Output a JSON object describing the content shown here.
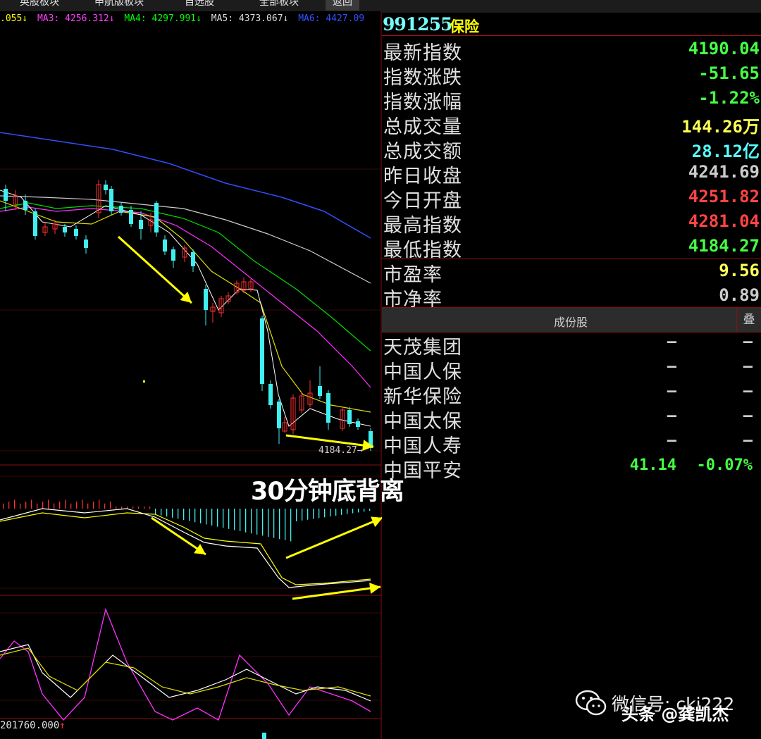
{
  "tabs": [
    {
      "label": "英股板块",
      "active": false
    },
    {
      "label": "申航版板块",
      "active": false
    },
    {
      "label": "自选股",
      "active": false
    },
    {
      "label": "全部板块",
      "active": false
    },
    {
      "label": "返回",
      "active": true
    }
  ],
  "ma_line": [
    {
      "text": ".055↓",
      "color": "#ffff00"
    },
    {
      "text": "MA3: 4256.312↓",
      "color": "#ff40ff"
    },
    {
      "text": "MA4: 4297.991↓",
      "color": "#00ff00"
    },
    {
      "text": "MA5: 4373.067↓",
      "color": "#dddddd"
    },
    {
      "text": "MA6: 4427.09",
      "color": "#3050ff"
    }
  ],
  "quote": {
    "code": "991255",
    "name": "保险",
    "rows": [
      {
        "label": "最新指数",
        "value": "4190.04",
        "color": "#44ff44"
      },
      {
        "label": "指数涨跌",
        "value": "-51.65",
        "color": "#44ff44"
      },
      {
        "label": "指数涨幅",
        "value": "-1.22%",
        "color": "#44ff44"
      },
      {
        "label": "总成交量",
        "value": "144.26万",
        "color": "#ffff55"
      },
      {
        "label": "总成交额",
        "value": "28.12亿",
        "color": "#55ffff"
      },
      {
        "label": "昨日收盘",
        "value": "4241.69",
        "color": "#cccccc"
      },
      {
        "label": "今日开盘",
        "value": "4251.82",
        "color": "#ff4444"
      },
      {
        "label": "最高指数",
        "value": "4281.04",
        "color": "#ff4444"
      },
      {
        "label": "最低指数",
        "value": "4184.27",
        "color": "#44ff44"
      }
    ],
    "ratios": [
      {
        "label": "市盈率",
        "value": "9.56",
        "color": "#ffff55"
      },
      {
        "label": "市净率",
        "value": "0.89",
        "color": "#cccccc"
      }
    ]
  },
  "constituents": {
    "title": "成份股",
    "toggle_label": "叠",
    "items": [
      {
        "name": "天茂集团",
        "price": "—",
        "change": "—",
        "color": "#cccccc"
      },
      {
        "name": "中国人保",
        "price": "—",
        "change": "—",
        "color": "#cccccc"
      },
      {
        "name": "新华保险",
        "price": "—",
        "change": "—",
        "color": "#cccccc"
      },
      {
        "name": "中国太保",
        "price": "—",
        "change": "—",
        "color": "#cccccc"
      },
      {
        "name": "中国人寿",
        "price": "—",
        "change": "—",
        "color": "#cccccc"
      },
      {
        "name": "中国平安",
        "price": "41.14",
        "change": "-0.07%",
        "color": "#44ff44"
      }
    ]
  },
  "chart": {
    "low_price_tag": "4184.27→",
    "annotation": "30分钟底背离",
    "volume_label": "201760.000",
    "volume_arrow": "↑"
  },
  "colors": {
    "up": "#ff3030",
    "down": "#40f0f0",
    "grid": "#8a1010",
    "arrow": "#ffff00"
  },
  "watermark": {
    "line1": "微信号: ckj222",
    "line2": "头条 @龚凯杰"
  }
}
